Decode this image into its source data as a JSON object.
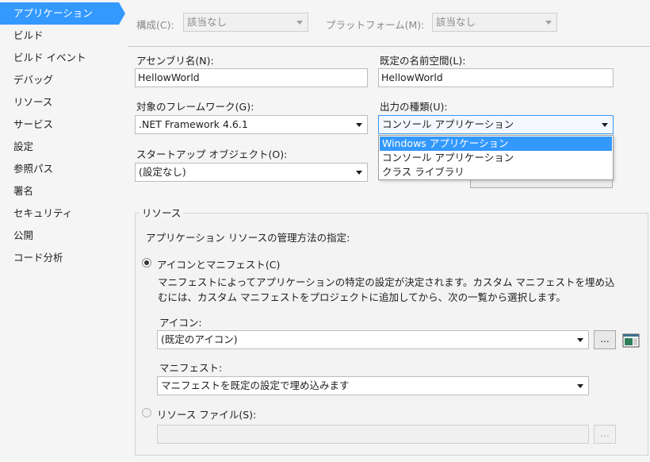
{
  "sidebar": {
    "items": [
      {
        "label": "アプリケーション",
        "active": true
      },
      {
        "label": "ビルド"
      },
      {
        "label": "ビルド イベント"
      },
      {
        "label": "デバッグ"
      },
      {
        "label": "リソース"
      },
      {
        "label": "サービス"
      },
      {
        "label": "設定"
      },
      {
        "label": "参照パス"
      },
      {
        "label": "署名"
      },
      {
        "label": "セキュリティ"
      },
      {
        "label": "公開"
      },
      {
        "label": "コード分析"
      }
    ]
  },
  "toolbar": {
    "config_label": "構成(C):",
    "config_value": "該当なし",
    "platform_label": "プラットフォーム(M):",
    "platform_value": "該当なし"
  },
  "form": {
    "assembly_name_label": "アセンブリ名(N):",
    "assembly_name_value": "HellowWorld",
    "namespace_label": "既定の名前空間(L):",
    "namespace_value": "HellowWorld",
    "framework_label": "対象のフレームワーク(G):",
    "framework_value": ".NET Framework 4.6.1",
    "output_type_label": "出力の種類(U):",
    "output_type_value": "コンソール アプリケーション",
    "output_type_options": [
      "Windows アプリケーション",
      "コンソール アプリケーション",
      "クラス ライブラリ"
    ],
    "startup_label": "スタートアップ オブジェクト(O):",
    "startup_value": "(設定なし)"
  },
  "resources": {
    "group_title": "リソース",
    "intro": "アプリケーション リソースの管理方法の指定:",
    "icon_manifest_label": "アイコンとマニフェスト(C)",
    "description": "マニフェストによってアプリケーションの特定の設定が決定されます。カスタム マニフェストを埋め込むには、カスタム マニフェストをプロジェクトに追加してから、次の一覧から選択します。",
    "icon_label": "アイコン:",
    "icon_value": "(既定のアイコン)",
    "browse_label": "...",
    "manifest_label": "マニフェスト:",
    "manifest_value": "マニフェストを既定の設定で埋め込みます",
    "resource_file_label": "リソース ファイル(S):",
    "resource_file_value": ""
  },
  "colors": {
    "accent": "#3399ff",
    "background": "#f5f5f5"
  }
}
